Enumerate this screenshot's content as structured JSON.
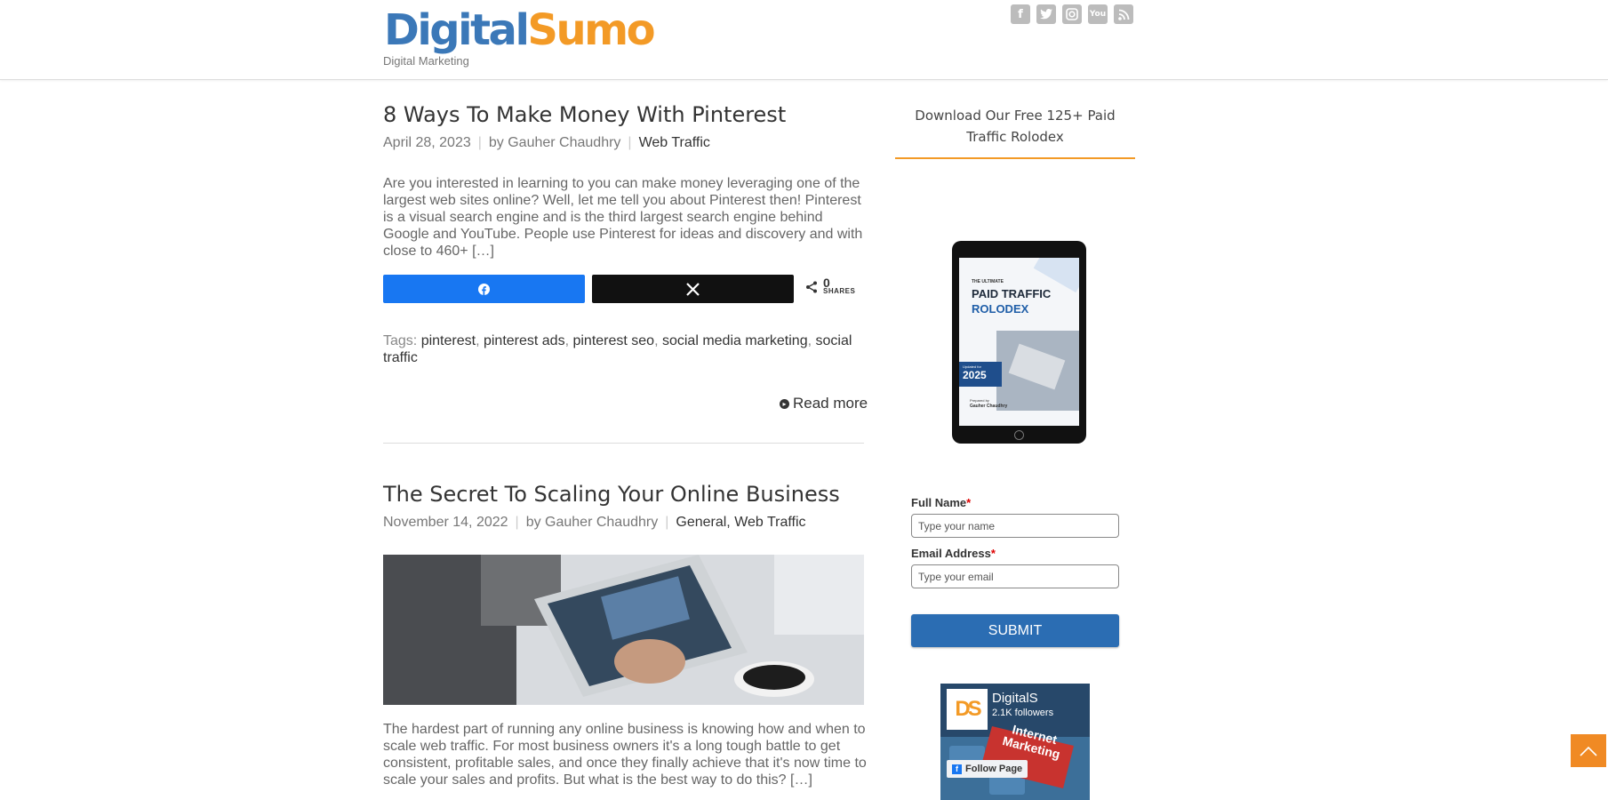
{
  "header": {
    "logo_part1": "Digital",
    "logo_part2": "Sumo",
    "tagline": "Digital Marketing",
    "social_icons": [
      "facebook-icon",
      "twitter-icon",
      "instagram-icon",
      "youtube-icon",
      "rss-icon"
    ]
  },
  "posts": [
    {
      "title": "8 Ways To Make Money With Pinterest",
      "date": "April 28, 2023",
      "author": "by Gauher Chaudhry",
      "categories": [
        "Web Traffic"
      ],
      "excerpt": "Are you interested in learning to you can make money leveraging one of the largest web sites online? Well, let me tell you about Pinterest then! Pinterest is a visual search engine and is the third largest search engine behind Google and YouTube. People use Pinterest for ideas and discovery and with close to 460+ […]",
      "share_count": "0",
      "share_label": "SHARES",
      "tags_label": "Tags:",
      "tags": [
        "pinterest",
        "pinterest ads",
        "pinterest seo",
        "social media marketing",
        "social traffic"
      ],
      "read_more": "Read more"
    },
    {
      "title": "The Secret To Scaling Your Online Business",
      "date": "November 14, 2022",
      "author": "by Gauher Chaudhry",
      "categories": [
        "General",
        "Web Traffic"
      ],
      "excerpt": "The hardest part of running any online business is knowing how and when to scale web traffic. For most business owners it's a long tough battle to get consistent, profitable sales, and once they finally achieve that it's now time to scale your sales and profits. But what is the best way to do this? […]"
    }
  ],
  "sidebar": {
    "title": "Download Our Free 125+ Paid Traffic Rolodex",
    "ebook": {
      "line1": "THE ULTIMATE",
      "line2": "PAID TRAFFIC",
      "line3": "ROLODEX",
      "badge_small": "Updated for",
      "badge_year": "2025",
      "prepared_by": "Prepared by",
      "author": "Gauher Chaudhry"
    },
    "form": {
      "name_label": "Full Name",
      "name_placeholder": "Type your name",
      "email_label": "Email Address",
      "email_placeholder": "Type your email",
      "required_mark": "*",
      "submit": "SUBMIT"
    },
    "facebook": {
      "page_name": "DigitalS",
      "followers": "2.1K followers",
      "follow_button": "Follow Page",
      "logo_text": "DS",
      "banner_line1": "Internet",
      "banner_line2": "Marketing"
    }
  },
  "colors": {
    "brand_blue": "#3b78b8",
    "brand_orange": "#f39a26",
    "facebook_blue": "#1877f2",
    "submit_blue": "#2b6db3"
  }
}
